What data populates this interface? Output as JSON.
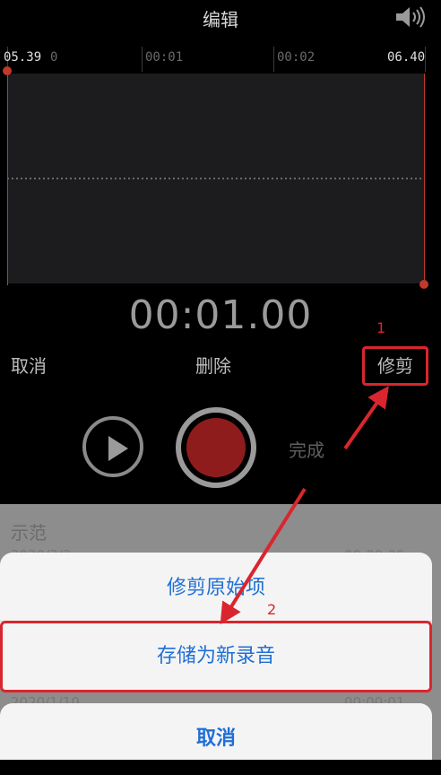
{
  "header": {
    "title": "编辑"
  },
  "ruler": {
    "labels": [
      "05.39",
      "00:01",
      "00:02",
      "06.40"
    ],
    "partial_label": "0"
  },
  "time_readout": "00:01.00",
  "actions": {
    "cancel": "取消",
    "delete": "删除",
    "trim": "修剪",
    "done": "完成"
  },
  "list": {
    "item_title": "示范",
    "item_date": "2020/3/2",
    "item_duration": "00:00:00",
    "item2_date": "2020/1/10",
    "item2_duration": "00:00:01"
  },
  "sheet": {
    "trim_original": "修剪原始项",
    "save_new": "存储为新录音",
    "cancel": "取消"
  },
  "annotations": {
    "step1": "1",
    "step2": "2"
  },
  "colors": {
    "accent": "#1f6fd6",
    "highlight": "#d9262e",
    "record": "#8f1c1c"
  }
}
